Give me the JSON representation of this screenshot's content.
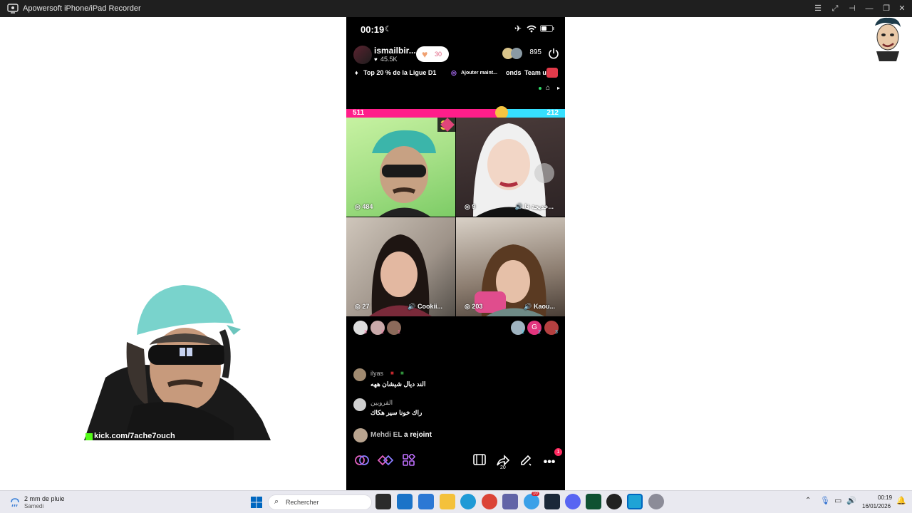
{
  "window": {
    "title": "Apowersoft iPhone/iPad Recorder",
    "controls": [
      "list-icon",
      "fullscreen-icon",
      "pin-icon",
      "minimize-icon",
      "restore-icon",
      "close-icon"
    ]
  },
  "phone": {
    "status": {
      "time": "00:19"
    },
    "host": {
      "name": "ismailbir...",
      "likes": "45.5K",
      "like_pill": "30"
    },
    "viewers": {
      "count": "895"
    },
    "ticker": {
      "rank": "Top 20 % de la Ligue D1",
      "add": "Ajouter maint...",
      "trailing": "onds",
      "team": "Team u"
    },
    "battle": {
      "left_score": "511",
      "right_score": "212",
      "round": "3",
      "left_share": 0.71
    },
    "tiles": [
      {
        "score": "484",
        "label": ""
      },
      {
        "score": "9",
        "label": "خديجة فا..."
      },
      {
        "score": "27",
        "label": "Cookii..."
      },
      {
        "score": "203",
        "label": "Kaou..."
      }
    ],
    "rankers_left": [
      "3",
      "2",
      "1"
    ],
    "rankers_right": [
      "1",
      "2",
      "3"
    ],
    "chat": [
      {
        "name": "ilyas",
        "message": "الند ديال شيشان ههه"
      },
      {
        "name": "القرويين",
        "message": "راك خونا سير هكاك"
      }
    ],
    "join": {
      "name": "Mehdi EL",
      "text": "a rejoint"
    },
    "bottom_bar": {
      "badge": "1",
      "share_count": "20",
      "icons": [
        "link-icon",
        "battle-icon",
        "apps-icon",
        "clip-icon",
        "share-icon",
        "edit-icon",
        "more-icon"
      ]
    }
  },
  "webcam": {
    "overlay_text": "kick.com/7ache7ouch"
  },
  "taskbar": {
    "weather": {
      "line1": "2 mm de pluie",
      "line2": "Samedi"
    },
    "search_placeholder": "Rechercher",
    "clock": {
      "time": "00:19",
      "date": "16/01/2026"
    },
    "badges": {
      "app1": "10"
    },
    "colors": {
      "taskbar_bg": "#e9e9f0",
      "accent": "#0067c0"
    }
  }
}
